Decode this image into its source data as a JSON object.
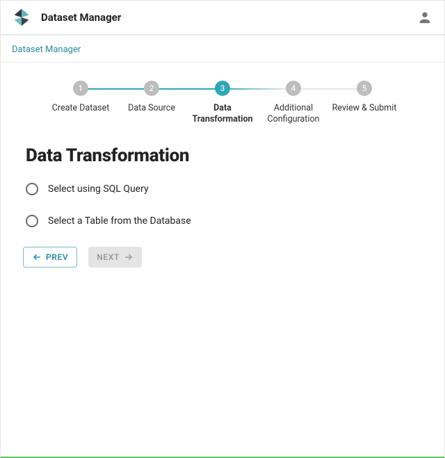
{
  "header": {
    "title": "Dataset Manager"
  },
  "breadcrumb": {
    "items": [
      {
        "label": "Dataset Manager"
      }
    ]
  },
  "stepper": {
    "current": 3,
    "steps": [
      {
        "num": "1",
        "label": "Create Dataset"
      },
      {
        "num": "2",
        "label": "Data Source"
      },
      {
        "num": "3",
        "label": "Data Transformation"
      },
      {
        "num": "4",
        "label": "Additional Configuration"
      },
      {
        "num": "5",
        "label": "Review & Submit"
      }
    ]
  },
  "page": {
    "heading": "Data Transformation",
    "options": {
      "sql": {
        "label": "Select using SQL Query",
        "selected": false
      },
      "table": {
        "label": "Select a Table from the Database",
        "selected": false
      }
    }
  },
  "nav": {
    "prev": "PREV",
    "next": "NEXT",
    "next_enabled": false
  }
}
